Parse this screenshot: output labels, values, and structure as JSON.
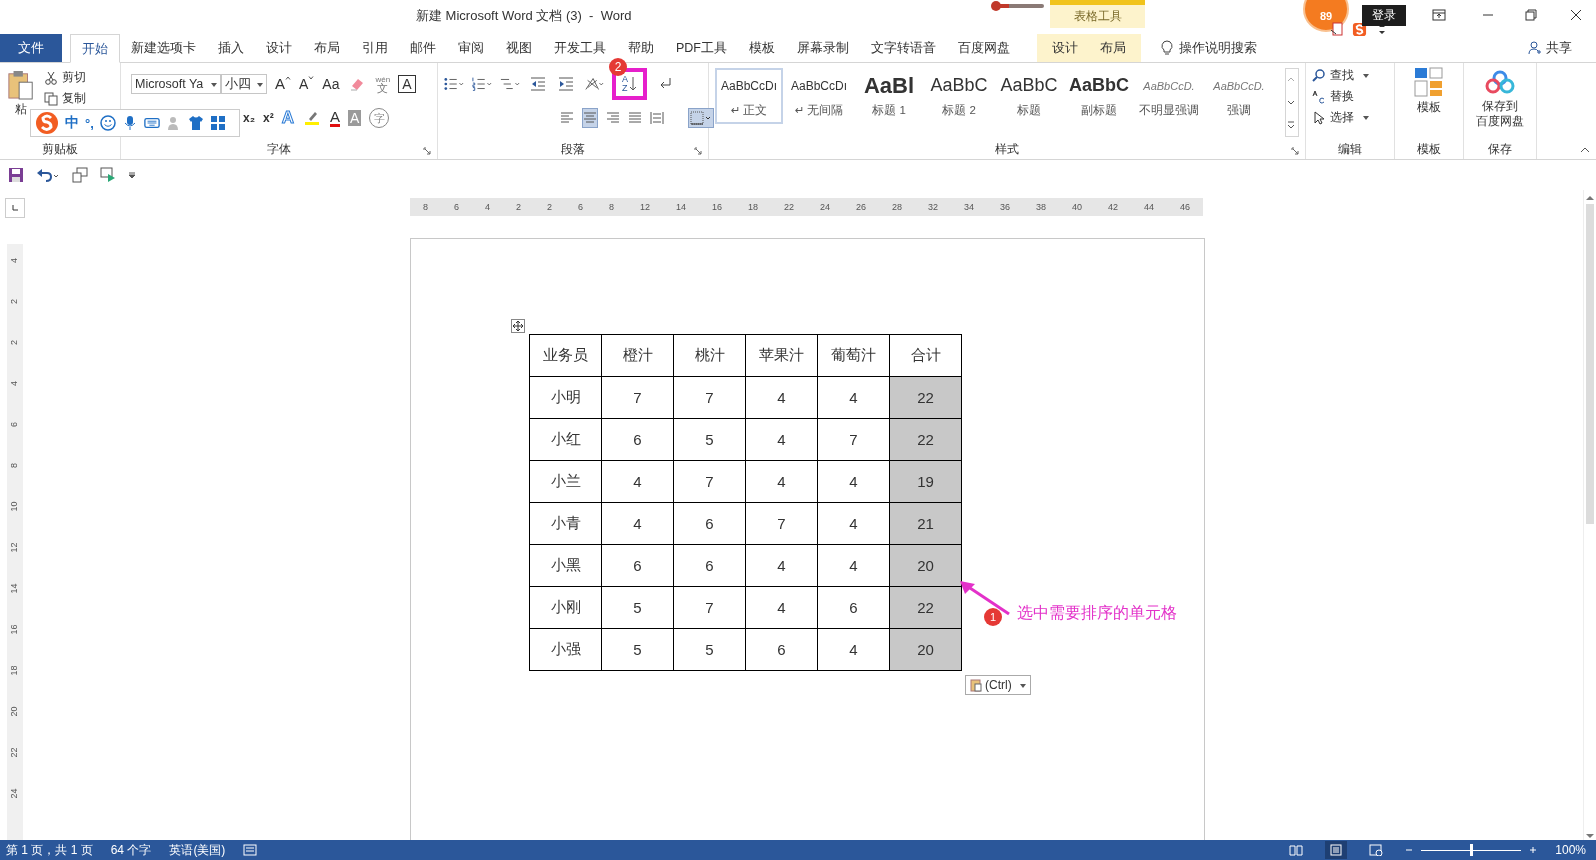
{
  "window": {
    "title": "新建 Microsoft Word 文档 (3)  -  Word",
    "context_group": "表格工具",
    "score_badge": "89",
    "login": "登录"
  },
  "menu_tabs": [
    {
      "label": "文件",
      "kind": "file",
      "selected": false
    },
    {
      "label": "开始",
      "kind": "normal",
      "selected": true
    },
    {
      "label": "新建选项卡",
      "kind": "normal",
      "selected": false
    },
    {
      "label": "插入",
      "kind": "normal",
      "selected": false
    },
    {
      "label": "设计",
      "kind": "normal",
      "selected": false
    },
    {
      "label": "布局",
      "kind": "normal",
      "selected": false
    },
    {
      "label": "引用",
      "kind": "normal",
      "selected": false
    },
    {
      "label": "邮件",
      "kind": "normal",
      "selected": false
    },
    {
      "label": "审阅",
      "kind": "normal",
      "selected": false
    },
    {
      "label": "视图",
      "kind": "normal",
      "selected": false
    },
    {
      "label": "开发工具",
      "kind": "normal",
      "selected": false
    },
    {
      "label": "帮助",
      "kind": "normal",
      "selected": false
    },
    {
      "label": "PDF工具",
      "kind": "normal",
      "selected": false
    },
    {
      "label": "模板",
      "kind": "normal",
      "selected": false
    },
    {
      "label": "屏幕录制",
      "kind": "normal",
      "selected": false
    },
    {
      "label": "文字转语音",
      "kind": "normal",
      "selected": false
    },
    {
      "label": "百度网盘",
      "kind": "normal",
      "selected": false
    },
    {
      "label": "设计",
      "kind": "contextual",
      "selected": false
    },
    {
      "label": "布局",
      "kind": "contextual",
      "selected": false
    }
  ],
  "tell_me": "操作说明搜索",
  "share": "共享",
  "clipboard": {
    "paste": "粘",
    "cut": "剪切",
    "copy": "复制",
    "label": "剪贴板"
  },
  "font": {
    "font_name": "Microsoft Ya",
    "font_size": "小四",
    "grow": "A",
    "shrink": "A",
    "change_case": "Aa",
    "phonetic_top": "wén",
    "phonetic": "文",
    "char_border": "A",
    "subscript": "x₂",
    "superscript": "x²",
    "effects": "A",
    "font_color": "A",
    "shading": "A",
    "enclose": "字",
    "label": "字体"
  },
  "paragraph": {
    "label": "段落",
    "sort_letters": [
      "A",
      "Z"
    ],
    "alignments": [
      {
        "kind": "left",
        "selected": false
      },
      {
        "kind": "center",
        "selected": true
      },
      {
        "kind": "right",
        "selected": false
      },
      {
        "kind": "justify",
        "selected": false
      },
      {
        "kind": "distributed",
        "selected": false
      }
    ],
    "borders_selected": true
  },
  "styles": {
    "label": "样式",
    "items": [
      {
        "preview": "AaBbCcDı",
        "name": "↵ 正文",
        "kind": "normal",
        "selected": true
      },
      {
        "preview": "AaBbCcDı",
        "name": "↵ 无间隔",
        "kind": "normal",
        "selected": false
      },
      {
        "preview": "AaBl",
        "name": "标题 1",
        "kind": "heading1",
        "selected": false
      },
      {
        "preview": "AaBbC",
        "name": "标题 2",
        "kind": "heading2",
        "selected": false
      },
      {
        "preview": "AaBbC",
        "name": "标题",
        "kind": "title",
        "selected": false
      },
      {
        "preview": "AaBbC",
        "name": "副标题",
        "kind": "subtitle",
        "selected": false
      },
      {
        "preview": "AaBbCcD.",
        "name": "不明显强调",
        "kind": "emphasis",
        "selected": false
      },
      {
        "preview": "AaBbCcD.",
        "name": "强调",
        "kind": "emphasis",
        "selected": false
      }
    ]
  },
  "editing": {
    "find": "查找",
    "replace": "替换",
    "select": "选择",
    "label": "编辑"
  },
  "template": {
    "button": "模板",
    "label": "模板"
  },
  "save_group": {
    "button_lines": [
      "保存到",
      "百度网盘"
    ],
    "label": "保存"
  },
  "ime_bar": {
    "mode": "中",
    "punct": "°,"
  },
  "ruler": {
    "ticks": [
      "8",
      "6",
      "4",
      "2",
      "2",
      "6",
      "8",
      "12",
      "14",
      "16",
      "18",
      "22",
      "24",
      "26",
      "28",
      "32",
      "34",
      "36",
      "38",
      "40",
      "42",
      "44",
      "46"
    ],
    "vertical_ticks": [
      "4",
      "2",
      "2",
      "4",
      "6",
      "8",
      "10",
      "12",
      "14",
      "16",
      "18",
      "20",
      "22",
      "24"
    ]
  },
  "table": {
    "columns": [
      {
        "label": "业务员",
        "selected": false
      },
      {
        "label": "橙汁",
        "selected": false
      },
      {
        "label": "桃汁",
        "selected": false
      },
      {
        "label": "苹果汁",
        "selected": false
      },
      {
        "label": "葡萄汁",
        "selected": false
      },
      {
        "label": "合计",
        "selected": true
      }
    ],
    "rows": [
      [
        "小明",
        "7",
        "7",
        "4",
        "4",
        "22"
      ],
      [
        "小红",
        "6",
        "5",
        "4",
        "7",
        "22"
      ],
      [
        "小兰",
        "4",
        "7",
        "4",
        "4",
        "19"
      ],
      [
        "小青",
        "4",
        "6",
        "7",
        "4",
        "21"
      ],
      [
        "小黑",
        "6",
        "6",
        "4",
        "4",
        "20"
      ],
      [
        "小刚",
        "5",
        "7",
        "4",
        "6",
        "22"
      ],
      [
        "小强",
        "5",
        "5",
        "6",
        "4",
        "20"
      ]
    ]
  },
  "paste_options": "(Ctrl)",
  "annotations": [
    {
      "number": "1",
      "text": "选中需要排序的单元格"
    },
    {
      "number": "2"
    }
  ],
  "status_bar": {
    "page": "第 1 页，共 1 页",
    "words": "64 个字",
    "language": "英语(美国)",
    "zoom": "100%",
    "zoom_slider": {
      "level": 0.5
    },
    "views": [
      {
        "kind": "read",
        "selected": false
      },
      {
        "kind": "print",
        "selected": true
      },
      {
        "kind": "web",
        "selected": false
      }
    ]
  }
}
